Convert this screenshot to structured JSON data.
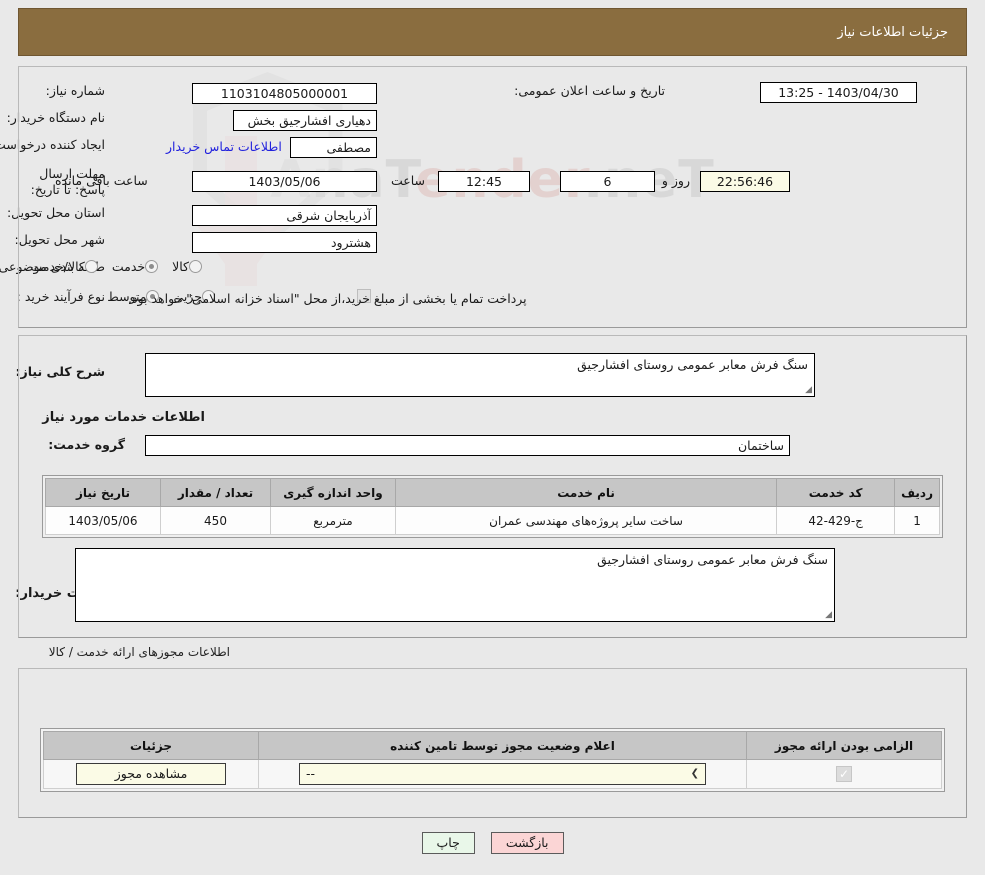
{
  "header": {
    "title": "جزئیات اطلاعات نیاز"
  },
  "main": {
    "need_number_label": "شماره نیاز:",
    "need_number_value": "1103104805000001",
    "announce_label": "تاریخ و ساعت اعلان عمومی:",
    "announce_value": "1403/04/30 - 13:25",
    "buyer_org_label": "نام دستگاه خریدار:",
    "buyer_org_value": "دهیاری افشارجیق بخش مرکزی شهرستان هشترود",
    "requester_label": "ایجاد کننده درخواست:",
    "requester_value": "مصطفی حسین پور دهیار دهیاری افشارجیق بخش مرکزی شهرستان هشترود",
    "contact_link": "اطلاعات تماس خریدار",
    "deadline_label": "مهلت ارسال پاسخ: تا تاریخ:",
    "deadline_date": "1403/05/06",
    "hour_label": "ساعت",
    "deadline_time": "12:45",
    "days_value": "6",
    "days_label": "روز و",
    "countdown_value": "22:56:46",
    "remaining_label": "ساعت باقی مانده",
    "province_label": "استان محل تحویل:",
    "province_value": "آذربایجان شرقی",
    "city_label": "شهر محل تحویل:",
    "city_value": "هشترود",
    "category_label": "طبقه بندی موضوعی:",
    "category_options": [
      "کالا",
      "خدمت",
      "کالا/خدمت"
    ],
    "category_selected": "خدمت",
    "process_label": "نوع فرآیند خرید :",
    "process_options": [
      "جزیی",
      "متوسط"
    ],
    "process_selected": "متوسط",
    "payment_note": "پرداخت تمام یا بخشی از مبلغ خرید،از محل \"اسناد خزانه اسلامی\" خواهد بود."
  },
  "body": {
    "summary_label": "شرح کلی نیاز:",
    "summary_value": "سنگ فرش معابر عمومی روستای افشارجیق",
    "services_heading": "اطلاعات خدمات مورد نیاز",
    "service_group_label": "گروه خدمت:",
    "service_group_value": "ساختمان",
    "table": {
      "columns": [
        "ردیف",
        "کد خدمت",
        "نام خدمت",
        "واحد اندازه گیری",
        "تعداد / مقدار",
        "تاریخ نیاز"
      ],
      "rows": [
        {
          "row": "1",
          "code": "ج-429-42",
          "name": "ساخت سایر پروژه‌های مهندسی عمران",
          "unit": "مترمربع",
          "qty": "450",
          "date": "1403/05/06"
        }
      ]
    },
    "buyer_notes_label": "توضیحات خریدار:",
    "buyer_notes_value": "سنگ فرش معابر عمومی روستای افشارجیق"
  },
  "permits": {
    "heading": "اطلاعات مجوزهای ارائه خدمت / کالا",
    "columns": [
      "الزامی بودن ارائه مجوز",
      "اعلام وضعیت مجوز توسط تامین کننده",
      "جزئیات"
    ],
    "rows": [
      {
        "required_checked": true,
        "status_value": "--",
        "details_button": "مشاهده مجوز"
      }
    ]
  },
  "footer": {
    "print_label": "چاپ",
    "back_label": "بازگشت"
  },
  "watermark": {
    "text_a": "AnaT",
    "text_b": "ender",
    "text_c": ".neT"
  },
  "colors": {
    "header_bar": "#8a6d3f",
    "link": "#2222dd",
    "btn_print": "#e9f7e9",
    "btn_back": "#fbd5d5",
    "yellow_field": "#fbfbe6",
    "table_header": "#c6c6c6"
  }
}
